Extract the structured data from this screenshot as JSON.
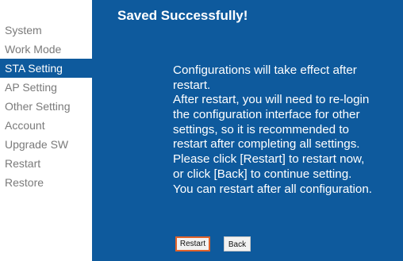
{
  "sidebar": {
    "items": [
      {
        "label": "System"
      },
      {
        "label": "Work Mode"
      },
      {
        "label": "STA Setting",
        "active": true
      },
      {
        "label": "AP Setting"
      },
      {
        "label": "Other Setting"
      },
      {
        "label": "Account"
      },
      {
        "label": "Upgrade SW"
      },
      {
        "label": "Restart"
      },
      {
        "label": "Restore"
      }
    ]
  },
  "main": {
    "title": "Saved Successfully!",
    "message_lines": [
      "Configurations will take effect after",
      "restart.",
      "After restart, you will need to re-login",
      "the configuration interface for other",
      "settings, so it is recommended to",
      "restart after completing all settings.",
      "Please click [Restart] to restart now,",
      "or click [Back] to continue setting.",
      "You can restart after all configuration."
    ],
    "restart_button": "Restart",
    "back_button": "Back"
  },
  "colors": {
    "panel_background": "#0e5a9d",
    "sidebar_text": "#7a7a7a",
    "active_item_background": "#0e5a9d",
    "restart_button_border": "#e0622a"
  }
}
